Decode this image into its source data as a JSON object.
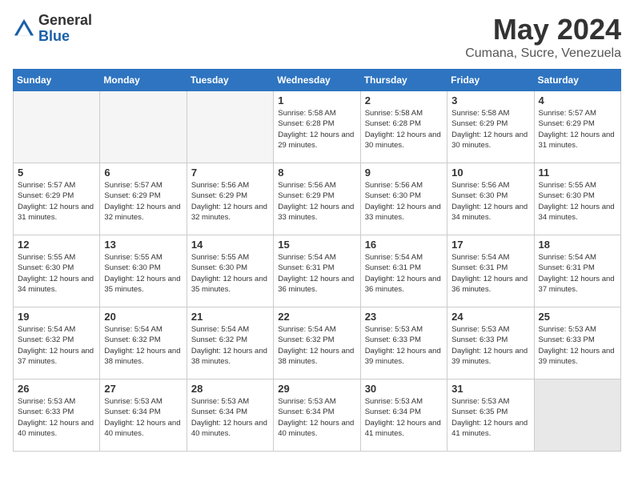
{
  "header": {
    "logo_general": "General",
    "logo_blue": "Blue",
    "month_title": "May 2024",
    "location": "Cumana, Sucre, Venezuela"
  },
  "calendar": {
    "weekdays": [
      "Sunday",
      "Monday",
      "Tuesday",
      "Wednesday",
      "Thursday",
      "Friday",
      "Saturday"
    ],
    "weeks": [
      [
        {
          "day": "",
          "empty": true
        },
        {
          "day": "",
          "empty": true
        },
        {
          "day": "",
          "empty": true
        },
        {
          "day": "1",
          "sunrise": "5:58 AM",
          "sunset": "6:28 PM",
          "daylight": "12 hours and 29 minutes."
        },
        {
          "day": "2",
          "sunrise": "5:58 AM",
          "sunset": "6:28 PM",
          "daylight": "12 hours and 30 minutes."
        },
        {
          "day": "3",
          "sunrise": "5:58 AM",
          "sunset": "6:29 PM",
          "daylight": "12 hours and 30 minutes."
        },
        {
          "day": "4",
          "sunrise": "5:57 AM",
          "sunset": "6:29 PM",
          "daylight": "12 hours and 31 minutes."
        }
      ],
      [
        {
          "day": "5",
          "sunrise": "5:57 AM",
          "sunset": "6:29 PM",
          "daylight": "12 hours and 31 minutes."
        },
        {
          "day": "6",
          "sunrise": "5:57 AM",
          "sunset": "6:29 PM",
          "daylight": "12 hours and 32 minutes."
        },
        {
          "day": "7",
          "sunrise": "5:56 AM",
          "sunset": "6:29 PM",
          "daylight": "12 hours and 32 minutes."
        },
        {
          "day": "8",
          "sunrise": "5:56 AM",
          "sunset": "6:29 PM",
          "daylight": "12 hours and 33 minutes."
        },
        {
          "day": "9",
          "sunrise": "5:56 AM",
          "sunset": "6:30 PM",
          "daylight": "12 hours and 33 minutes."
        },
        {
          "day": "10",
          "sunrise": "5:56 AM",
          "sunset": "6:30 PM",
          "daylight": "12 hours and 34 minutes."
        },
        {
          "day": "11",
          "sunrise": "5:55 AM",
          "sunset": "6:30 PM",
          "daylight": "12 hours and 34 minutes."
        }
      ],
      [
        {
          "day": "12",
          "sunrise": "5:55 AM",
          "sunset": "6:30 PM",
          "daylight": "12 hours and 34 minutes."
        },
        {
          "day": "13",
          "sunrise": "5:55 AM",
          "sunset": "6:30 PM",
          "daylight": "12 hours and 35 minutes."
        },
        {
          "day": "14",
          "sunrise": "5:55 AM",
          "sunset": "6:30 PM",
          "daylight": "12 hours and 35 minutes."
        },
        {
          "day": "15",
          "sunrise": "5:54 AM",
          "sunset": "6:31 PM",
          "daylight": "12 hours and 36 minutes."
        },
        {
          "day": "16",
          "sunrise": "5:54 AM",
          "sunset": "6:31 PM",
          "daylight": "12 hours and 36 minutes."
        },
        {
          "day": "17",
          "sunrise": "5:54 AM",
          "sunset": "6:31 PM",
          "daylight": "12 hours and 36 minutes."
        },
        {
          "day": "18",
          "sunrise": "5:54 AM",
          "sunset": "6:31 PM",
          "daylight": "12 hours and 37 minutes."
        }
      ],
      [
        {
          "day": "19",
          "sunrise": "5:54 AM",
          "sunset": "6:32 PM",
          "daylight": "12 hours and 37 minutes."
        },
        {
          "day": "20",
          "sunrise": "5:54 AM",
          "sunset": "6:32 PM",
          "daylight": "12 hours and 38 minutes."
        },
        {
          "day": "21",
          "sunrise": "5:54 AM",
          "sunset": "6:32 PM",
          "daylight": "12 hours and 38 minutes."
        },
        {
          "day": "22",
          "sunrise": "5:54 AM",
          "sunset": "6:32 PM",
          "daylight": "12 hours and 38 minutes."
        },
        {
          "day": "23",
          "sunrise": "5:53 AM",
          "sunset": "6:33 PM",
          "daylight": "12 hours and 39 minutes."
        },
        {
          "day": "24",
          "sunrise": "5:53 AM",
          "sunset": "6:33 PM",
          "daylight": "12 hours and 39 minutes."
        },
        {
          "day": "25",
          "sunrise": "5:53 AM",
          "sunset": "6:33 PM",
          "daylight": "12 hours and 39 minutes."
        }
      ],
      [
        {
          "day": "26",
          "sunrise": "5:53 AM",
          "sunset": "6:33 PM",
          "daylight": "12 hours and 40 minutes."
        },
        {
          "day": "27",
          "sunrise": "5:53 AM",
          "sunset": "6:34 PM",
          "daylight": "12 hours and 40 minutes."
        },
        {
          "day": "28",
          "sunrise": "5:53 AM",
          "sunset": "6:34 PM",
          "daylight": "12 hours and 40 minutes."
        },
        {
          "day": "29",
          "sunrise": "5:53 AM",
          "sunset": "6:34 PM",
          "daylight": "12 hours and 40 minutes."
        },
        {
          "day": "30",
          "sunrise": "5:53 AM",
          "sunset": "6:34 PM",
          "daylight": "12 hours and 41 minutes."
        },
        {
          "day": "31",
          "sunrise": "5:53 AM",
          "sunset": "6:35 PM",
          "daylight": "12 hours and 41 minutes."
        },
        {
          "day": "",
          "empty": true,
          "shaded": true
        }
      ]
    ]
  }
}
